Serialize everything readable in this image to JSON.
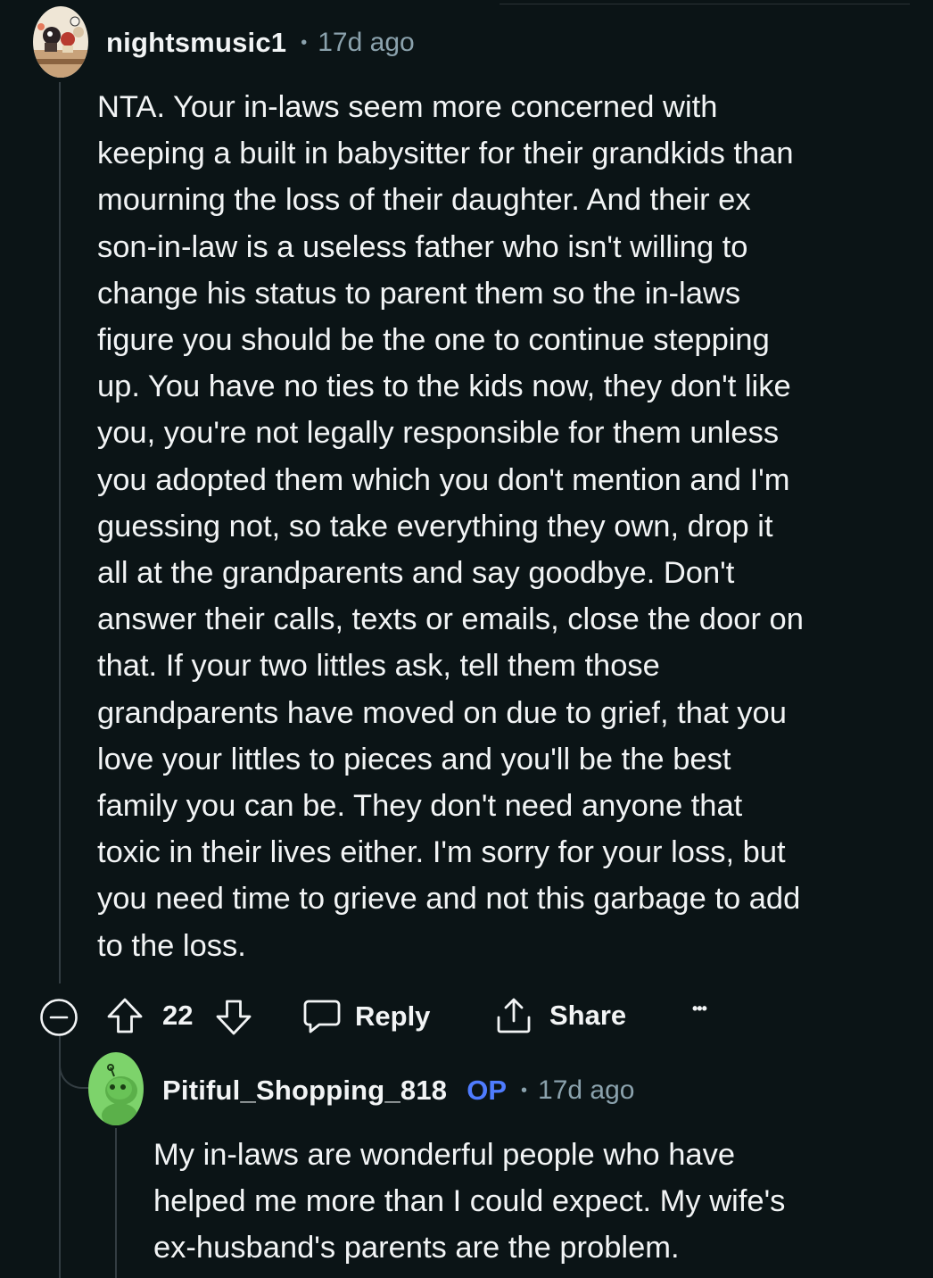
{
  "comment": {
    "username": "nightsmusic1",
    "separator": "•",
    "time": "17d ago",
    "avatar_icon": "user-avatar-icon",
    "lines": [
      "NTA. Your in-laws seem more concerned with",
      "keeping a built in babysitter for their grandkids than",
      "mourning the loss of their daughter. And their ex",
      "son-in-law is a useless father who isn't willing to",
      "change his status to parent them so the in-laws",
      "figure you should be the one to continue stepping",
      "up. You have no ties to the kids now, they don't like",
      "you, you're not legally responsible for them unless",
      "you adopted them which you don't mention and I'm",
      "guessing not, so take everything they own, drop it",
      "all at the grandparents and say goodbye. Don't",
      "answer their calls, texts or emails, close the door on",
      "that. If your two littles ask, tell them those",
      "grandparents have moved on due to grief, that you",
      "love your littles to pieces and you'll be the best",
      "family you can be. They don't need anyone that",
      "toxic in their lives either. I'm sorry for your loss, but",
      "you need time to grieve and not this garbage to add",
      "to the loss."
    ]
  },
  "actions": {
    "collapse_icon": "collapse-minus-icon",
    "upvote_icon": "upvote-arrow-icon",
    "score": "22",
    "downvote_icon": "downvote-arrow-icon",
    "reply_icon": "speech-bubble-icon",
    "reply_label": "Reply",
    "share_icon": "share-upload-icon",
    "share_label": "Share",
    "more_label": "•••"
  },
  "reply": {
    "username": "Pitiful_Shopping_818",
    "op_badge": "OP",
    "separator": "•",
    "time": "17d ago",
    "avatar_icon": "snoo-avatar-icon",
    "lines": [
      "My in-laws are wonderful people who have",
      "helped me more than I could expect. My wife's",
      "ex-husband's parents are the problem."
    ]
  },
  "colors": {
    "background": "#0b1416",
    "text": "#f2f4f5",
    "muted": "#8ba2ad",
    "op_badge": "#4f7cff",
    "thread_line": "#333d42",
    "reply_avatar": "#7dd36b"
  }
}
